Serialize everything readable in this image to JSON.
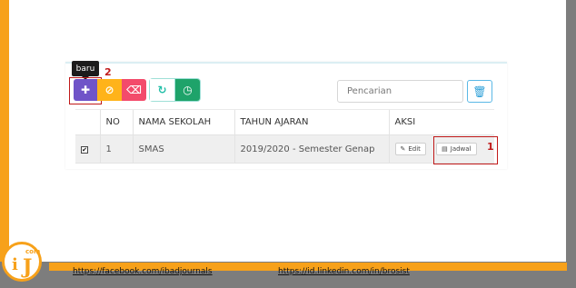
{
  "toolbar": {
    "tooltip": "baru",
    "add_icon": "plus-icon",
    "cancel_icon": "ban-icon",
    "delete_icon": "eraser-icon",
    "refresh_icon": "refresh-icon",
    "clock_icon": "clock-icon"
  },
  "search": {
    "placeholder": "Pencarian",
    "trash_icon": "trash-icon"
  },
  "table": {
    "columns": [
      "NO",
      "NAMA SEKOLAH",
      "TAHUN AJARAN",
      "AKSI"
    ],
    "rows": [
      {
        "no": "1",
        "sekolah": "SMAS",
        "tahun": "2019/2020 - Semester Genap",
        "edit_label": "Edit",
        "jadwal_label": "Jadwal"
      }
    ]
  },
  "annotations": {
    "callout_1": "1",
    "callout_2": "2"
  },
  "footer": {
    "facebook": "https://facebook.com/ibadjournals",
    "linkedin": "https://id.linkedin.com/in/brosist"
  },
  "logo": {
    "com": "com",
    "i": "i",
    "j": "J"
  },
  "colors": {
    "accent_orange": "#f7a11a",
    "purple": "#6f54c8",
    "yellow": "#ffb31a",
    "pink": "#f34b6b",
    "teal": "#23bfa8",
    "green": "#1ea36a",
    "blue": "#2b9fd8",
    "red_highlight": "#c01919"
  }
}
